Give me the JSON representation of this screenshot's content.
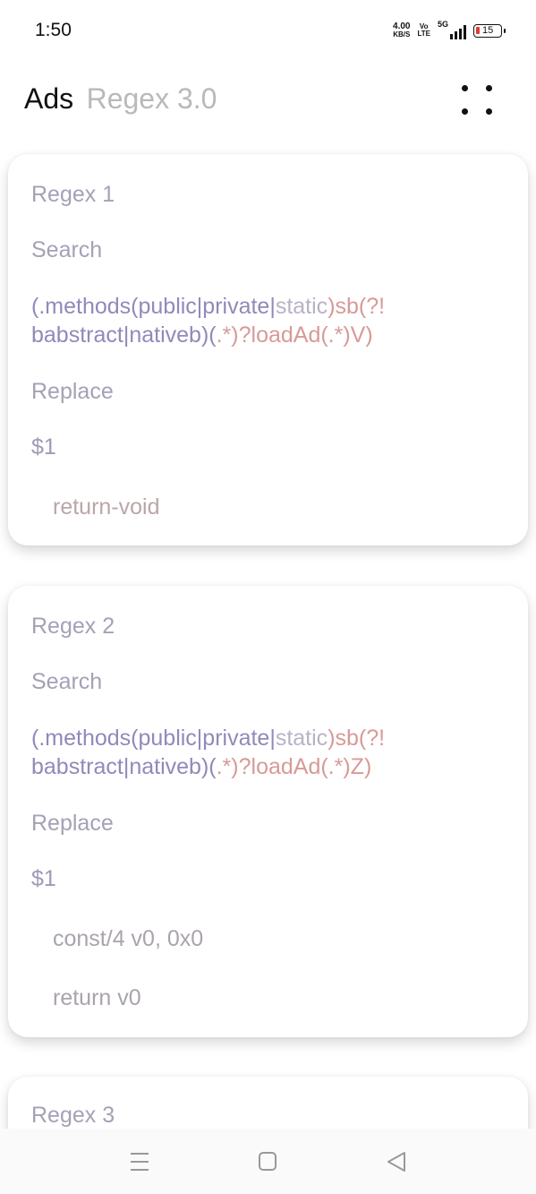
{
  "status_bar": {
    "time": "1:50",
    "net_speed_value": "4.00",
    "net_speed_unit": "KB/S",
    "volte_top": "Vo",
    "volte_bottom": "LTE",
    "network": "5G",
    "battery_level": "15"
  },
  "header": {
    "title": "Ads",
    "subtitle": "Regex 3.0",
    "menu_icon": "more-dots-icon"
  },
  "cards": [
    {
      "title": "Regex 1",
      "search_label": "Search",
      "search_line1_a": "(.methods(public|private|",
      "search_line1_b": "static",
      "search_line1_c": ")sb(?!",
      "search_line2_a": "babstract|nativeb)(",
      "search_line2_b": ".*",
      "search_line2_c": ")?loadAd(.*)V)",
      "replace_label": "Replace",
      "replace_value": "$1",
      "code_lines": [
        "return-void"
      ]
    },
    {
      "title": "Regex 2",
      "search_label": "Search",
      "search_line1_a": "(.methods(public|private|",
      "search_line1_b": "static",
      "search_line1_c": ")sb(?!",
      "search_line2_a": "babstract|nativeb)(",
      "search_line2_b": ".*",
      "search_line2_c": ")?loadAd(.*)Z)",
      "replace_label": "Replace",
      "replace_value": "$1",
      "code_lines": [
        "const/4 v0, 0x0",
        "return v0"
      ]
    },
    {
      "title": "Regex 3"
    }
  ],
  "nav_bar": {
    "items": [
      "menu-icon",
      "home-icon",
      "back-icon"
    ]
  }
}
